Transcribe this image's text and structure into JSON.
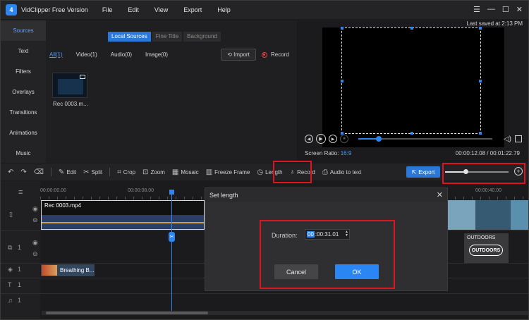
{
  "app": {
    "title": "VidClipper Free Version",
    "logo_text": "4",
    "menu": [
      "File",
      "Edit",
      "View",
      "Export",
      "Help"
    ],
    "win_controls": {
      "menu": "☰",
      "minimize": "—",
      "maximize": "☐",
      "close": "✕"
    }
  },
  "sidebar": {
    "items": [
      {
        "label": "Sources",
        "active": true
      },
      {
        "label": "Text"
      },
      {
        "label": "Filters"
      },
      {
        "label": "Overlays"
      },
      {
        "label": "Transitions"
      },
      {
        "label": "Animations"
      },
      {
        "label": "Music"
      }
    ]
  },
  "media": {
    "tabs": [
      "Local Sources",
      "Fine Title",
      "Background"
    ],
    "filters": [
      "All(1)",
      "Video(1)",
      "Audio(0)",
      "Image(0)"
    ],
    "import_label": "Import",
    "record_label": "Record",
    "items": [
      {
        "label": "Rec 0003.m..."
      }
    ]
  },
  "preview": {
    "saved_text": "Last saved at 2:13 PM",
    "ratio_label": "Screen Ratio:",
    "ratio_value": "16:9",
    "timecode": "00:00:12.08 / 00:01:22.79",
    "progress": 0.15
  },
  "toolbar": {
    "undo": "↶",
    "redo": "↷",
    "delete": "🗑",
    "edit": "Edit",
    "split": "Split",
    "crop": "Crop",
    "zoom": "Zoom",
    "mosaic": "Mosaic",
    "freeze": "Freeze Frame",
    "length": "Length",
    "record": "Record",
    "audio_to_text": "Audio to text",
    "export": "Export"
  },
  "timeline": {
    "ruler": [
      "00:00:00.00",
      "00:00:08.00",
      "00:00:40.00"
    ],
    "video_clip": "Rec 0003.mp4",
    "sticker_label": "OUTDOORS",
    "sticker_logo": "OUTDOORS",
    "text_clip": "Breathing B...",
    "track_nums": [
      "1",
      "1",
      "1",
      "1"
    ]
  },
  "dialog": {
    "title": "Set length",
    "duration_label": "Duration:",
    "duration_hours": "00",
    "duration_rest": ":00:31.01",
    "cancel": "Cancel",
    "ok": "OK"
  },
  "colors": {
    "accent": "#2a86f4",
    "highlight": "#e0141e"
  }
}
